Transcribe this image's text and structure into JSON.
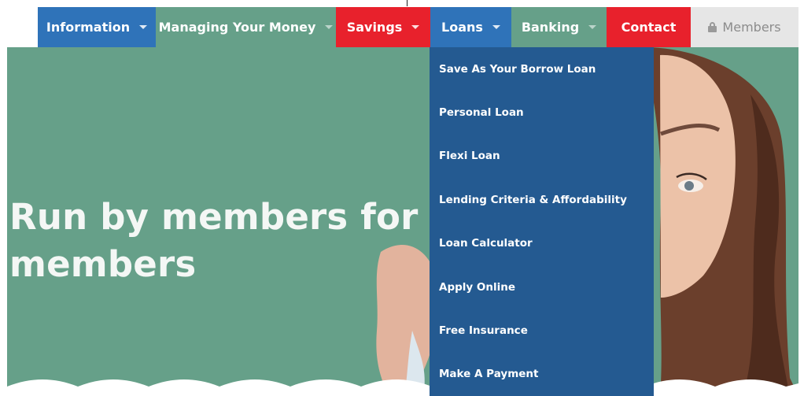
{
  "nav": {
    "items": [
      {
        "label": "Information",
        "has_caret": true,
        "bg": "#2f73b9"
      },
      {
        "label": "Managing Your Money",
        "has_caret": true,
        "bg": "#66a089"
      },
      {
        "label": "Savings",
        "has_caret": true,
        "bg": "#e8212c"
      },
      {
        "label": "Loans",
        "has_caret": true,
        "bg": "#2f73b9"
      },
      {
        "label": "Banking",
        "has_caret": true,
        "bg": "#66a089"
      },
      {
        "label": "Contact",
        "has_caret": false,
        "bg": "#e8212c"
      },
      {
        "label": "Members",
        "has_caret": false,
        "bg": "#e6e6e6"
      }
    ]
  },
  "loans_menu": {
    "items": [
      "Save As Your Borrow Loan",
      "Personal Loan",
      "Flexi Loan",
      "Lending Criteria & Affordability",
      "Loan Calculator",
      "Apply Online",
      "Free Insurance",
      "Make A Payment"
    ]
  },
  "hero": {
    "title_line1": "Run by members for",
    "title_line2": "members"
  },
  "colors": {
    "hero_bg": "#66a089",
    "dropdown_bg": "#245a91",
    "blue": "#2f73b9",
    "red": "#e8212c"
  },
  "icons": {
    "members_lock": "lock-icon",
    "dropdown_caret": "chevron-down-icon"
  }
}
